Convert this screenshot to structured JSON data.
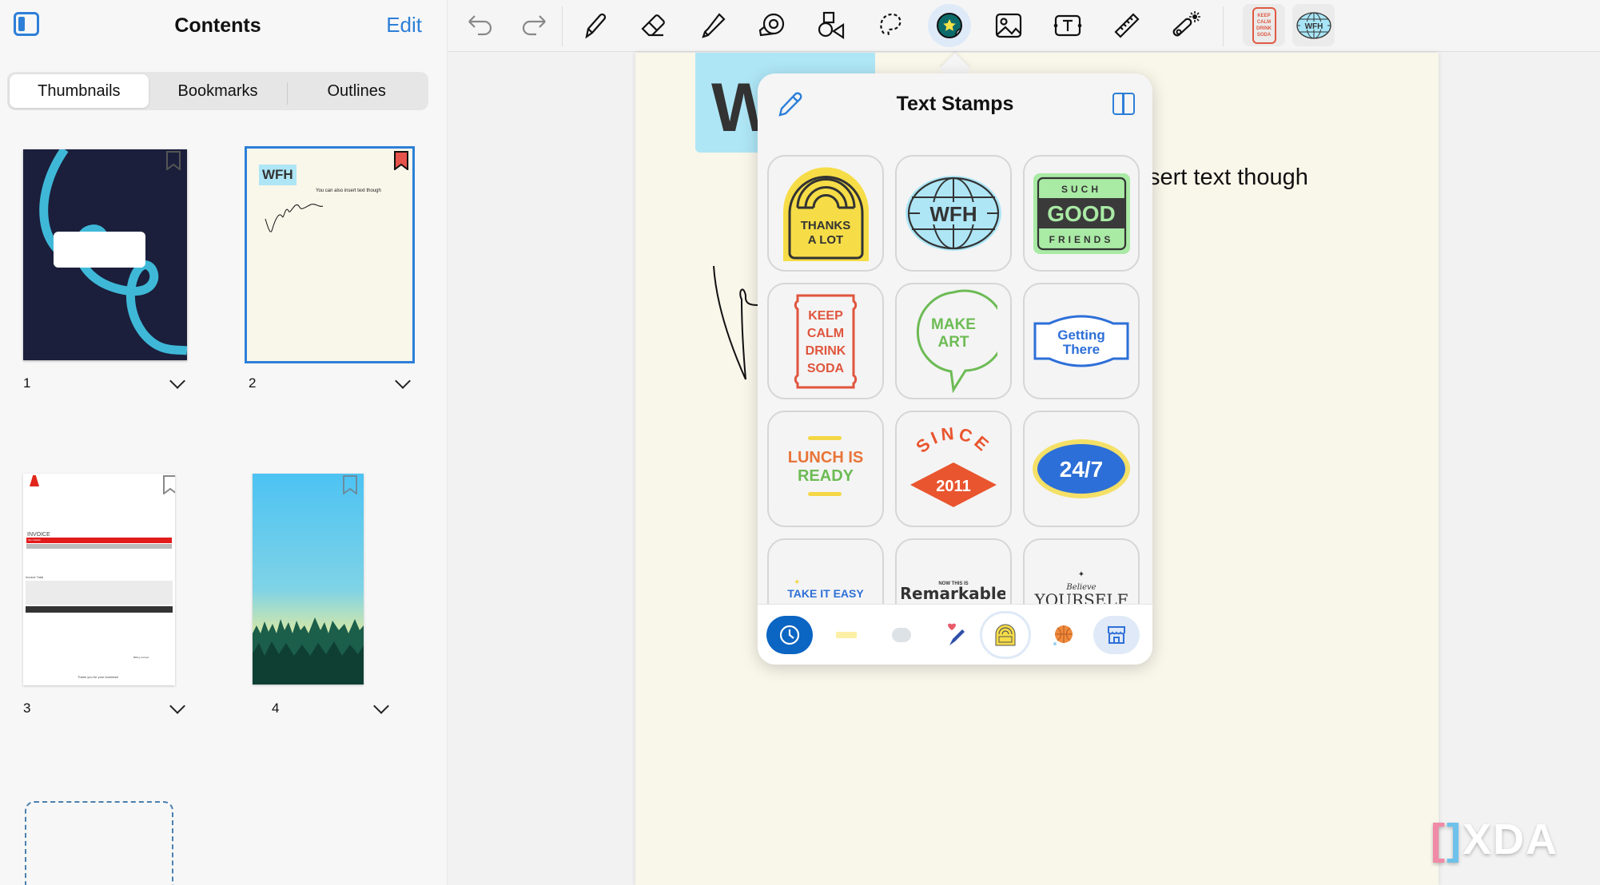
{
  "sidebar": {
    "title": "Contents",
    "edit_label": "Edit",
    "tabs": [
      {
        "label": "Thumbnails",
        "active": true
      },
      {
        "label": "Bookmarks",
        "active": false
      },
      {
        "label": "Outlines",
        "active": false
      }
    ],
    "pages": [
      {
        "number": "1",
        "bookmarked": false,
        "selected": false
      },
      {
        "number": "2",
        "bookmarked": true,
        "selected": true,
        "stamp": "WFH",
        "text": "You can also insert text though"
      },
      {
        "number": "3",
        "bookmarked": false,
        "selected": false,
        "heading": "INVOICE",
        "section": "Item Details",
        "total_label": "Invoice Total",
        "footer": "Thank you for your business!",
        "billing": "Billing Contact"
      },
      {
        "number": "4",
        "bookmarked": false,
        "selected": false
      }
    ]
  },
  "toolbar": {
    "tools": [
      {
        "name": "undo"
      },
      {
        "name": "redo"
      },
      {
        "name": "pen"
      },
      {
        "name": "eraser"
      },
      {
        "name": "highlighter"
      },
      {
        "name": "tape"
      },
      {
        "name": "shapes"
      },
      {
        "name": "lasso"
      },
      {
        "name": "stickers",
        "active": true
      },
      {
        "name": "image"
      },
      {
        "name": "text-box"
      },
      {
        "name": "ruler"
      },
      {
        "name": "laser-pointer"
      }
    ],
    "recent_stamps": [
      {
        "label": "KEEP CALM DRINK SODA"
      },
      {
        "label": "WFH"
      }
    ]
  },
  "document": {
    "stamp_text": "W",
    "body_text": "sert text though"
  },
  "popup": {
    "title": "Text Stamps",
    "stamps": [
      {
        "lines": [
          "THANKS",
          "A LOT"
        ]
      },
      {
        "lines": [
          "WFH"
        ]
      },
      {
        "lines": [
          "SUCH",
          "GOOD",
          "FRIENDS"
        ]
      },
      {
        "lines": [
          "KEEP",
          "CALM",
          "DRINK",
          "SODA"
        ]
      },
      {
        "lines": [
          "MAKE",
          "ART"
        ]
      },
      {
        "lines": [
          "Getting",
          "There"
        ]
      },
      {
        "lines": [
          "LUNCH IS",
          "READY"
        ]
      },
      {
        "lines": [
          "SINCE",
          "2011"
        ]
      },
      {
        "lines": [
          "24/7"
        ]
      },
      {
        "lines": [
          "TAKE IT EASY"
        ]
      },
      {
        "lines": [
          "NOW THIS IS",
          "Remarkable"
        ]
      },
      {
        "lines": [
          "Believe",
          "YOURSELF"
        ]
      }
    ],
    "categories": [
      {
        "name": "recent",
        "active": true
      },
      {
        "name": "tape"
      },
      {
        "name": "cloud"
      },
      {
        "name": "pen-heart"
      },
      {
        "name": "text-stamps",
        "selected": true
      },
      {
        "name": "basketball"
      },
      {
        "name": "store"
      }
    ]
  },
  "watermark": {
    "brand": "XDA"
  }
}
